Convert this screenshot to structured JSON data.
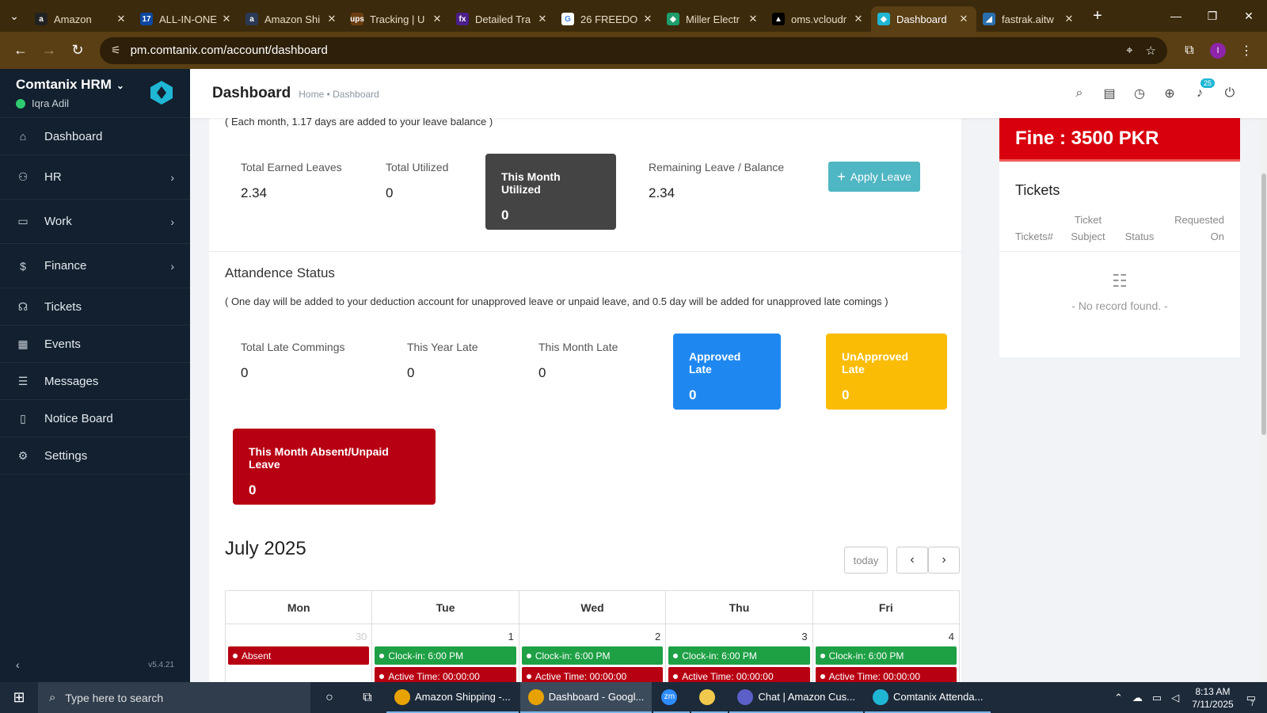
{
  "browser": {
    "tabs": [
      {
        "title": "Amazon",
        "fav": "a",
        "color": "#222222"
      },
      {
        "title": "ALL-IN-ONE",
        "fav": "17",
        "color": "#0d47a1"
      },
      {
        "title": "Amazon Shi",
        "fav": "a",
        "color": "#2a3a55"
      },
      {
        "title": "Tracking | U",
        "fav": "ups",
        "color": "#6b3e12"
      },
      {
        "title": "Detailed Tra",
        "fav": "fx",
        "color": "#4b1e8a"
      },
      {
        "title": "26 FREEDO",
        "fav": "G",
        "color": "#ffffff"
      },
      {
        "title": "Miller Electr",
        "fav": "◆",
        "color": "#1e9c6c"
      },
      {
        "title": "oms.vcloudr",
        "fav": "▲",
        "color": "#000000"
      },
      {
        "title": "Dashboard",
        "fav": "◆",
        "color": "#1fb6d4"
      },
      {
        "title": "fastrak.aitw",
        "fav": "◢",
        "color": "#2a6fb0"
      }
    ],
    "active_tab": 8,
    "url": "pm.comtanix.com/account/dashboard"
  },
  "sidebar": {
    "brand": "Comtanix HRM",
    "user": "Iqra Adil",
    "items": [
      {
        "label": "Dashboard",
        "icon": "home-icon",
        "glyph": "⌂",
        "chev": false
      },
      {
        "label": "HR",
        "icon": "users-icon",
        "glyph": "⚇",
        "chev": true
      },
      {
        "label": "Work",
        "icon": "briefcase-icon",
        "glyph": "▭",
        "chev": true
      },
      {
        "label": "Finance",
        "icon": "dollar-icon",
        "glyph": "$",
        "chev": true
      },
      {
        "label": "Tickets",
        "icon": "headset-icon",
        "glyph": "☊",
        "chev": false
      },
      {
        "label": "Events",
        "icon": "calendar-icon",
        "glyph": "▦",
        "chev": false
      },
      {
        "label": "Messages",
        "icon": "message-icon",
        "glyph": "☰",
        "chev": false
      },
      {
        "label": "Notice Board",
        "icon": "clipboard-icon",
        "glyph": "▯",
        "chev": false
      },
      {
        "label": "Settings",
        "icon": "gear-icon",
        "glyph": "⚙",
        "chev": false
      }
    ],
    "version": "v5.4.21"
  },
  "header": {
    "title": "Dashboard",
    "breadcrumb": "Home • Dashboard",
    "notif_count": "25"
  },
  "leave": {
    "note": "( Each month, 1.17 days are added to your leave balance )",
    "total_earned_label": "Total Earned Leaves",
    "total_earned": "2.34",
    "total_utilized_label": "Total Utilized",
    "total_utilized": "0",
    "month_utilized_label": "This Month Utilized",
    "month_utilized": "0",
    "remaining_label": "Remaining Leave / Balance",
    "remaining": "2.34",
    "apply_label": "Apply Leave"
  },
  "attendance": {
    "title": "Attandence Status",
    "note": "( One day will be added to your deduction account for unapproved leave or unpaid leave, and 0.5 day will be added for unapproved late comings )",
    "total_late_label": "Total Late Commings",
    "total_late": "0",
    "year_late_label": "This Year Late",
    "year_late": "0",
    "month_late_label": "This Month Late",
    "month_late": "0",
    "approved_label": "Approved Late",
    "approved": "0",
    "unapproved_label": "UnApproved Late",
    "unapproved": "0",
    "absent_label": "This Month Absent/Unpaid Leave",
    "absent": "0"
  },
  "calendar": {
    "title": "July 2025",
    "today_label": "today",
    "days": [
      "Mon",
      "Tue",
      "Wed",
      "Thu",
      "Fri"
    ],
    "cells": [
      {
        "day": "30",
        "prev": true,
        "events": [
          {
            "text": "Absent",
            "color": "red"
          }
        ]
      },
      {
        "day": "1",
        "prev": false,
        "events": [
          {
            "text": "Clock-in: 6:00 PM",
            "color": "green"
          },
          {
            "text": "Active Time: 00:00:00",
            "color": "red"
          }
        ]
      },
      {
        "day": "2",
        "prev": false,
        "events": [
          {
            "text": "Clock-in: 6:00 PM",
            "color": "green"
          },
          {
            "text": "Active Time: 00:00:00",
            "color": "red"
          }
        ]
      },
      {
        "day": "3",
        "prev": false,
        "events": [
          {
            "text": "Clock-in: 6:00 PM",
            "color": "green"
          },
          {
            "text": "Active Time: 00:00:00",
            "color": "red"
          }
        ]
      },
      {
        "day": "4",
        "prev": false,
        "events": [
          {
            "text": "Clock-in: 6:00 PM",
            "color": "green"
          },
          {
            "text": "Active Time: 00:00:00",
            "color": "red"
          }
        ]
      }
    ]
  },
  "fine": {
    "text": "Fine : 3500 PKR"
  },
  "tickets": {
    "title": "Tickets",
    "col_id": "Tickets#",
    "col_subject": "Ticket Subject",
    "col_status": "Status",
    "col_requested": "Requested On",
    "empty": "- No record found. -"
  },
  "taskbar": {
    "search_placeholder": "Type here to search",
    "apps": [
      {
        "label": "Amazon Shipping -...",
        "color": "#e8a200"
      },
      {
        "label": "Dashboard - Googl...",
        "color": "#e8a200",
        "active": true
      },
      {
        "label": "zm",
        "color": "#2d8cff",
        "icon_only": true
      },
      {
        "label": "",
        "color": "#f2c94c",
        "icon_only": true
      },
      {
        "label": "Chat | Amazon Cus...",
        "color": "#5b5fc7"
      },
      {
        "label": "Comtanix Attenda...",
        "color": "#1fb6d4"
      }
    ],
    "time": "8:13 AM",
    "date": "7/11/2025",
    "notif": "7"
  },
  "colors": {
    "sidebar": "#12202f",
    "absent": "#b70012",
    "approved": "#1e88f0",
    "unapproved": "#fbbc05",
    "utilized": "#444444",
    "fine": "#d9000d",
    "apply": "#4fb6c3"
  }
}
